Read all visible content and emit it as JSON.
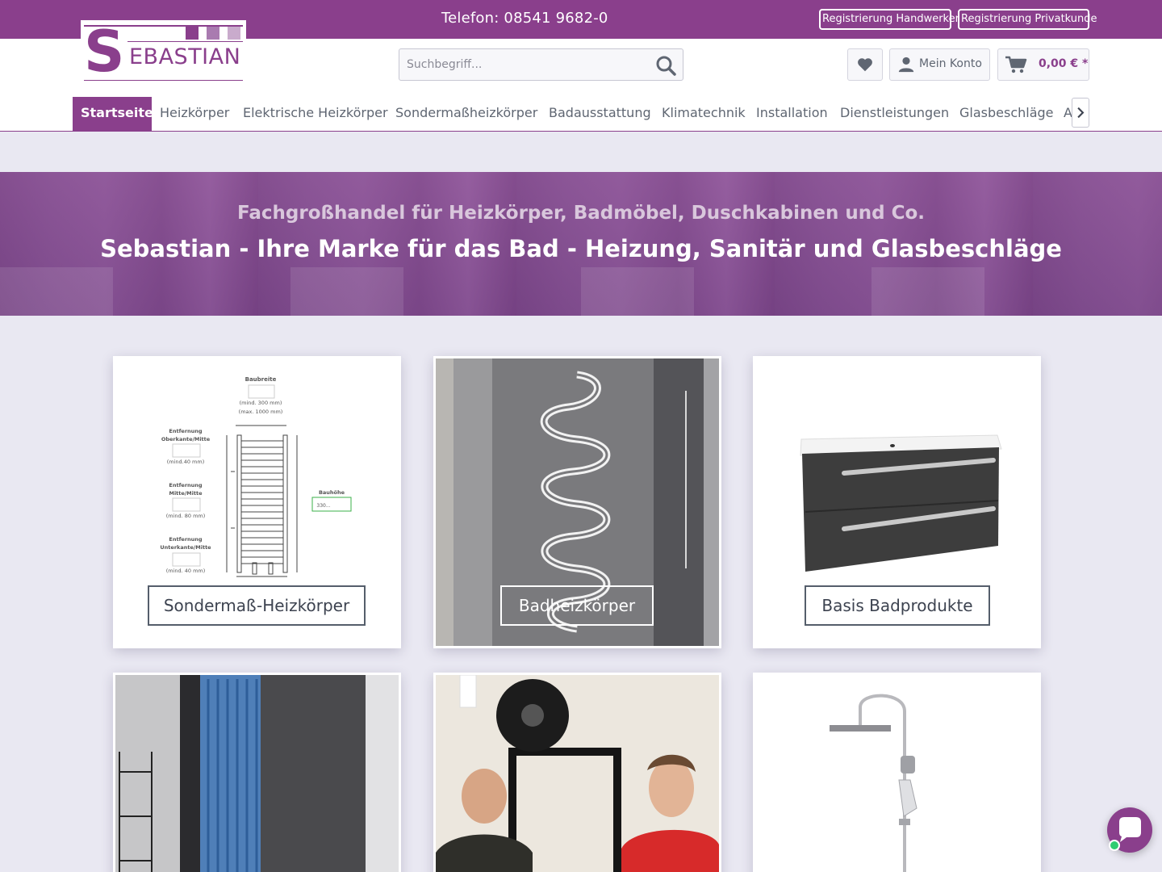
{
  "topbar": {
    "phone": "Telefon: 08541 9682-0",
    "register_craftsman": "Registrierung Handwerker",
    "register_private": "Registrierung Privatkunde"
  },
  "logo": {
    "initial": "S",
    "text": "EBASTIAN"
  },
  "search": {
    "placeholder": "Suchbegriff..."
  },
  "header": {
    "account_label": "Mein Konto",
    "cart_total": "0,00 € *"
  },
  "nav": {
    "items": [
      "Startseite",
      "Heizkörper",
      "Elektrische Heizkörper",
      "Sondermaßheizkörper",
      "Badausstattung",
      "Klimatechnik",
      "Installation",
      "Dienstleistungen",
      "Glasbeschläge",
      "A"
    ]
  },
  "hero": {
    "subtitle": "Fachgroßhandel für Heizkörper, Badmöbel, Duschkabinen und Co.",
    "title": "Sebastian - Ihre Marke für das Bad - Heizung, Sanitär und Glasbeschläge"
  },
  "tiles": [
    {
      "caption": "Sondermaß-Heizkörper"
    },
    {
      "caption": "Badheizkörper"
    },
    {
      "caption": "Basis Badprodukte"
    },
    {
      "caption": ""
    },
    {
      "caption": ""
    },
    {
      "caption": ""
    }
  ],
  "diagram": {
    "width_label": "Baubreite",
    "width_min": "(mind. 300 mm)",
    "width_max": "(max. 1000 mm)",
    "top_label_1": "Entfernung",
    "top_label_2": "Oberkante/Mitte",
    "top_min": "(mind.40 mm)",
    "mid_label_1": "Entfernung",
    "mid_label_2": "Mitte/Mitte",
    "mid_min": "(mind. 80 mm)",
    "bottom_label_1": "Entfernung",
    "bottom_label_2": "Unterkante/Mitte",
    "bottom_min": "(mind. 40 mm)",
    "height_label": "Bauhöhe",
    "height_value": "330..."
  },
  "colors": {
    "brand": "#8a3f8c",
    "background": "#e9e8f2"
  }
}
